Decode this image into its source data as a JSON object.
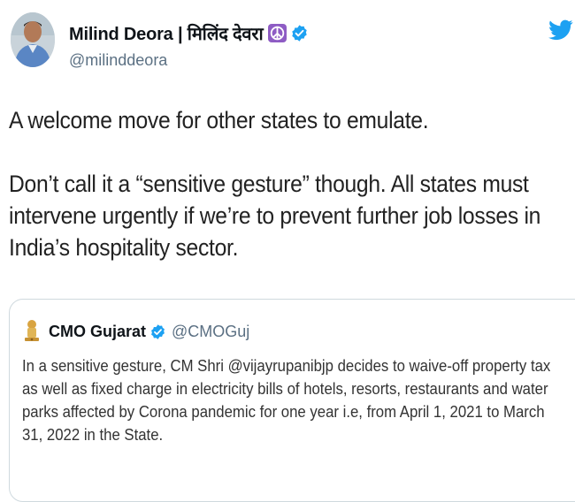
{
  "author": {
    "display_name": "Milind Deora | मिलिंद देवरा",
    "handle": "@milinddeora",
    "avatar_icon": "person-avatar",
    "peace_icon": "peace-symbol-emoji",
    "verified_icon": "verified-badge"
  },
  "platform": {
    "logo_icon": "twitter-bird-icon",
    "brand_color": "#1da1f2"
  },
  "tweet": {
    "paragraph_1": "A welcome move for other states to emulate.",
    "paragraph_2": "Don’t call it a “sensitive gesture” though. All states must intervene urgently if we’re to prevent further job losses in India’s hospitality sector."
  },
  "quoted_tweet": {
    "display_name": "CMO Gujarat",
    "handle": "@CMOGuj",
    "avatar_icon": "emblem-icon",
    "verified_icon": "verified-badge",
    "text": "In a sensitive gesture, CM Shri @vijayrupanibjp decides to waive-off property tax as well as fixed charge in electricity bills of hotels, resorts, restaurants and water parks affected by Corona pandemic for one year i.e, from April 1, 2021 to March 31, 2022 in the State."
  }
}
